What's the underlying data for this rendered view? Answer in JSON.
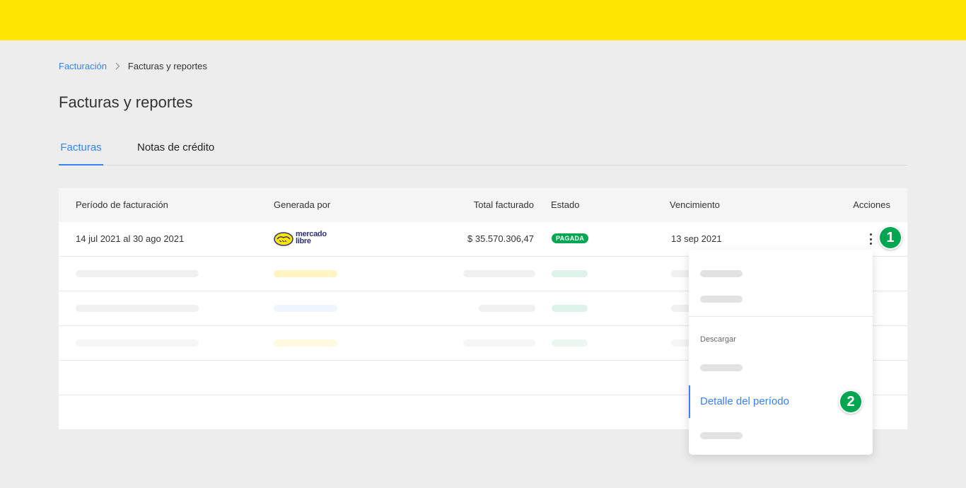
{
  "breadcrumb": {
    "parent": "Facturación",
    "current": "Facturas y reportes"
  },
  "page": {
    "title": "Facturas y reportes"
  },
  "tabs": [
    {
      "label": "Facturas",
      "active": true
    },
    {
      "label": "Notas de crédito",
      "active": false
    }
  ],
  "table": {
    "columns": [
      "Período de facturación",
      "Generada por",
      "Total facturado",
      "Estado",
      "Vencimiento",
      "Acciones"
    ],
    "rows": [
      {
        "period": "14 jul 2021 al 30 ago 2021",
        "generated_by": "mercado libre",
        "total": "$ 35.570.306,47",
        "status": "PAGADA",
        "due": "13 sep 2021"
      }
    ]
  },
  "logo": {
    "line1": "mercado",
    "line2": "libre"
  },
  "menu": {
    "section_heading": "Descargar",
    "active_item": "Detalle del período"
  },
  "steps": [
    "1",
    "2"
  ],
  "colors": {
    "topbar": "#ffe600",
    "accent": "#3483fa",
    "success": "#00a650",
    "background": "#ededed"
  },
  "icons": [
    "chevron-right-icon",
    "more-vertical-icon",
    "mercado-libre-logo"
  ]
}
